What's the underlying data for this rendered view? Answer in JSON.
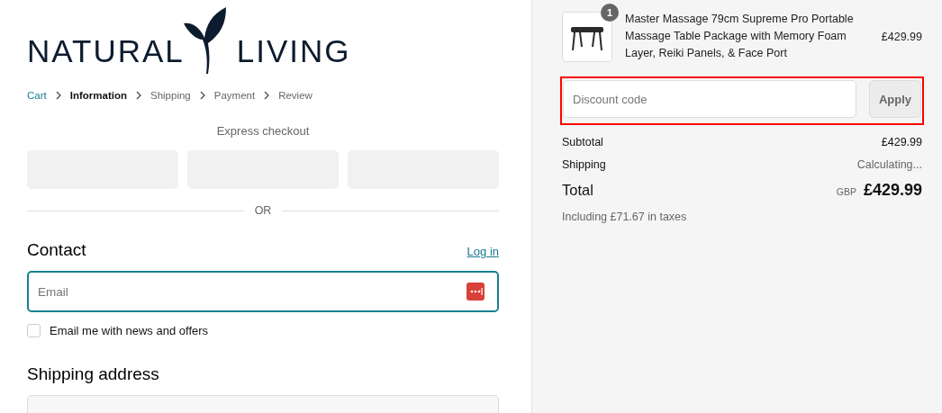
{
  "logo": {
    "left_word": "NATURAL",
    "right_word": "LIVING"
  },
  "breadcrumb": [
    {
      "label": "Cart",
      "selected": false,
      "completed": true
    },
    {
      "label": "Information",
      "selected": true,
      "completed": false
    },
    {
      "label": "Shipping",
      "selected": false,
      "completed": false
    },
    {
      "label": "Payment",
      "selected": false,
      "completed": false
    },
    {
      "label": "Review",
      "selected": false,
      "completed": false
    }
  ],
  "express_checkout": {
    "title": "Express checkout",
    "buttons": [
      {
        "kind": "blank"
      },
      {
        "kind": "blank"
      },
      {
        "kind": "blank"
      }
    ],
    "divider": "OR"
  },
  "contact": {
    "title": "Contact",
    "login_link": "Log in",
    "email": {
      "placeholder": "Email",
      "focused": true
    },
    "newsletter": {
      "label": "Email me with news and offers",
      "checked": false
    }
  },
  "shipping_address": {
    "title": "Shipping address",
    "fields": [
      {
        "kind": "select"
      }
    ]
  },
  "order_summary": {
    "items": [
      {
        "quantity": "1",
        "name": "Master Massage 79cm Supreme Pro Portable Massage Table Package with Memory Foam Layer, Reiki Panels, & Face Port",
        "price": "£429.99"
      }
    ],
    "discount": {
      "placeholder": "Discount code",
      "button": "Apply",
      "highlighted": true
    },
    "lines": [
      {
        "label": "Subtotal",
        "value": "£429.99",
        "kind": "amount"
      },
      {
        "label": "Shipping",
        "value": "Calculating...",
        "kind": "pending"
      }
    ],
    "total": {
      "label": "Total",
      "currency": "GBP",
      "value": "£429.99"
    },
    "taxes_note": "Including £71.67 in taxes"
  }
}
